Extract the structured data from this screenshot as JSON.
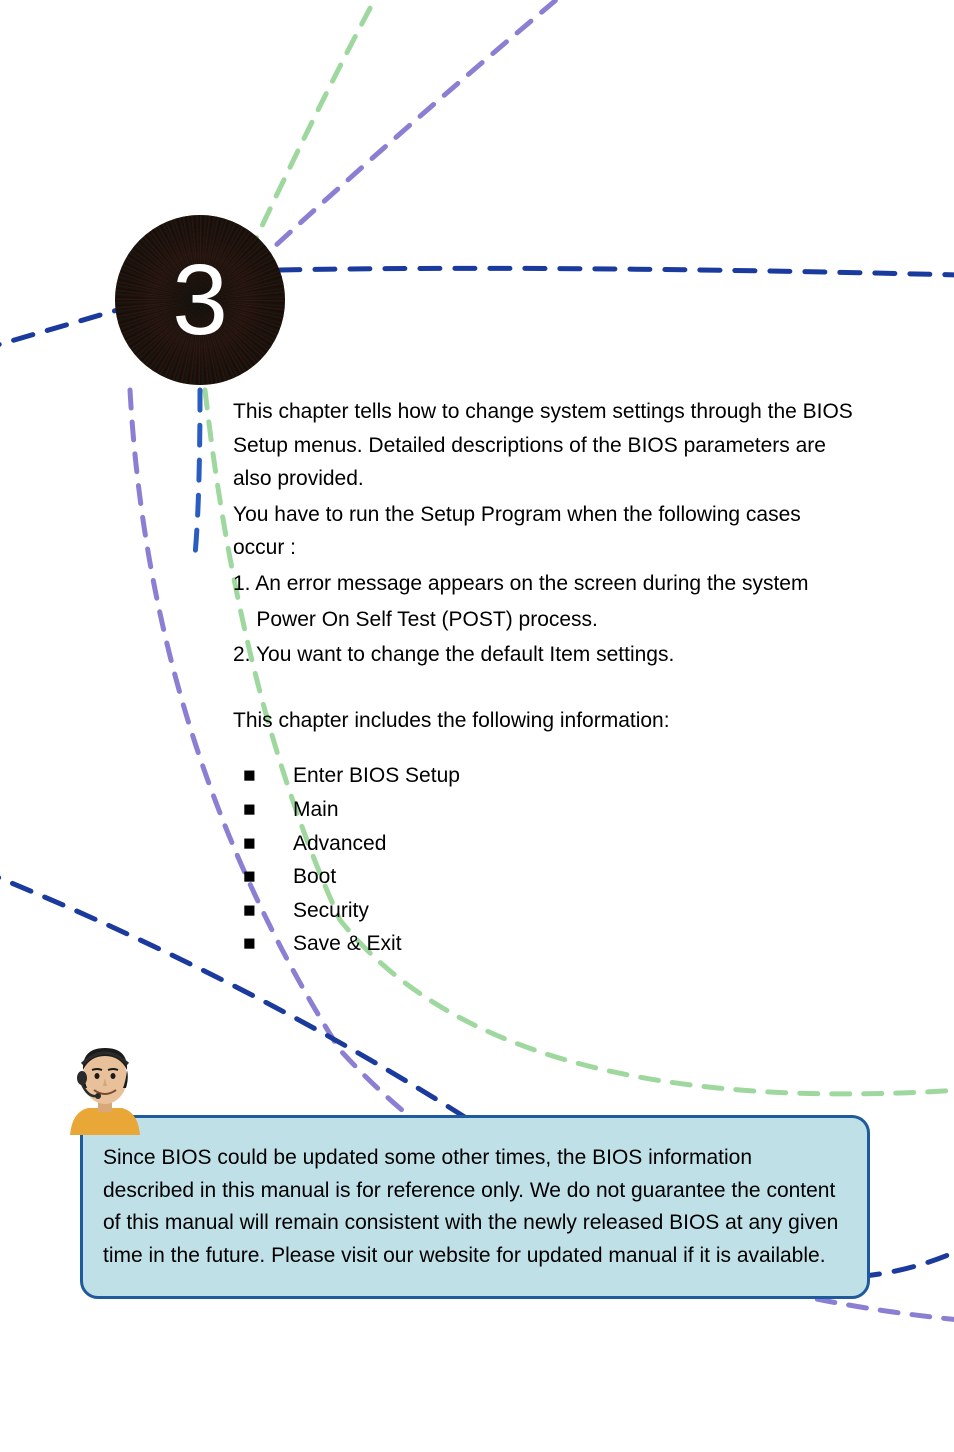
{
  "chapter": {
    "number": "3"
  },
  "intro": {
    "paragraph1": "This chapter tells how to change system settings through the BIOS Setup menus. Detailed descriptions of the BIOS parameters are also provided.",
    "paragraph2": "You have to run the Setup Program when the following cases occur :",
    "item1": "1. An error message appears on the screen during the system",
    "item1b": "    Power On Self Test (POST) process.",
    "item2": "2. You want to change the default Item settings.",
    "paragraph3": "This chapter includes the following information:"
  },
  "toc": {
    "items": [
      {
        "label": "Enter BIOS Setup"
      },
      {
        "label": "Main"
      },
      {
        "label": "Advanced"
      },
      {
        "label": "Boot"
      },
      {
        "label": "Security"
      },
      {
        "label": "Save & Exit"
      }
    ]
  },
  "note": {
    "text": "Since BIOS could be updated some other times, the BIOS information described in this manual is for reference only. We do not guarantee the content of this manual will remain consistent with the newly released BIOS at any given time in the future. Please visit our website for updated manual if it is available."
  },
  "colors": {
    "noteBg": "#c0e0e8",
    "noteBorder": "#1e5a9c",
    "curveBlueDark": "#1a3a9e",
    "curvePurple": "#8b7fd3",
    "curveGreen": "#9fd89f"
  }
}
